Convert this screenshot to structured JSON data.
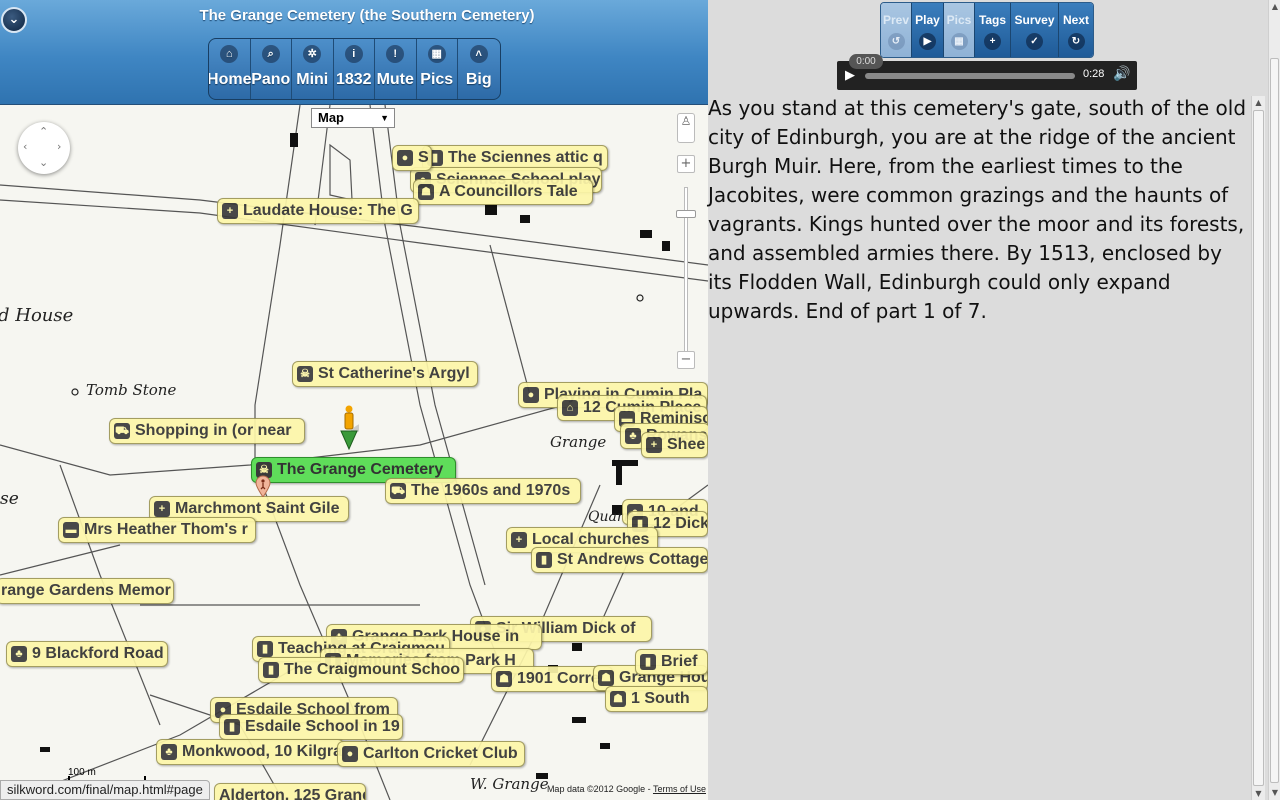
{
  "header": {
    "title": "The Grange Cemetery (the Southern Cemetery)",
    "nav": [
      {
        "label": "Home",
        "icon": "home-icon",
        "glyph": "⌂"
      },
      {
        "label": "Pano",
        "icon": "search-icon",
        "glyph": "⌕"
      },
      {
        "label": "Mini",
        "icon": "gear-icon",
        "glyph": "✲"
      },
      {
        "label": "1832",
        "icon": "info-icon",
        "glyph": "i"
      },
      {
        "label": "Mute",
        "icon": "alert-icon",
        "glyph": "!"
      },
      {
        "label": "Pics",
        "icon": "grid-icon",
        "glyph": "▦"
      },
      {
        "label": "Big",
        "icon": "chevron-up-icon",
        "glyph": "˄"
      }
    ]
  },
  "map": {
    "type_selector": "Map",
    "labels": {
      "house": "d House",
      "tombstone": "Tomb Stone",
      "grange": "Grange",
      "quarry": "Quarry",
      "se": "se",
      "street": "W. Grange"
    },
    "pins": [
      {
        "label": "The Sciennes attic q",
        "icon": "book-icon",
        "glyph": "▮"
      },
      {
        "label": "Sciennes School play",
        "icon": "pin-icon",
        "glyph": "●"
      },
      {
        "label": "S",
        "icon": "pin-icon",
        "glyph": "●"
      },
      {
        "label": "A Councillors Tale",
        "icon": "person-icon",
        "glyph": "☗"
      },
      {
        "label": "Laudate House: The G",
        "icon": "plus-icon",
        "glyph": "+"
      },
      {
        "label": "St Catherine's Argyl",
        "icon": "skull-icon",
        "glyph": "☠"
      },
      {
        "label": "Playing in Cumin Pla",
        "icon": "pin-icon",
        "glyph": "●"
      },
      {
        "label": "12 Cumin Place",
        "icon": "house-icon",
        "glyph": "⌂"
      },
      {
        "label": "Reminisc",
        "icon": "chat-icon",
        "glyph": "▬"
      },
      {
        "label": "Rowans",
        "icon": "tree-icon",
        "glyph": "♣"
      },
      {
        "label": "Shee",
        "icon": "plus-icon",
        "glyph": "+"
      },
      {
        "label": "Shopping in (or near",
        "icon": "cart-icon",
        "glyph": "⛟"
      },
      {
        "label": "The Grange Cemetery",
        "icon": "skull-icon",
        "glyph": "☠"
      },
      {
        "label": "The 1960s and 1970s",
        "icon": "cart-icon",
        "glyph": "⛟"
      },
      {
        "label": "Marchmont Saint Gile",
        "icon": "plus-icon",
        "glyph": "+"
      },
      {
        "label": "Mrs Heather Thom's r",
        "icon": "chat-icon",
        "glyph": "▬"
      },
      {
        "label": "10 and",
        "icon": "pin-icon",
        "glyph": "●"
      },
      {
        "label": "12 Dick",
        "icon": "book-icon",
        "glyph": "▮"
      },
      {
        "label": "Local churches",
        "icon": "plus-icon",
        "glyph": "+"
      },
      {
        "label": "St Andrews Cottage",
        "icon": "book-icon",
        "glyph": "▮"
      },
      {
        "label": "range Gardens Memor",
        "icon": "none",
        "glyph": ""
      },
      {
        "label": "Sir William Dick of",
        "icon": "pin-icon",
        "glyph": "●"
      },
      {
        "label": "Grange Park House in",
        "icon": "tree-icon",
        "glyph": "♣"
      },
      {
        "label": "9 Blackford Road",
        "icon": "tree-icon",
        "glyph": "♣"
      },
      {
        "label": "Teaching at Craigmou",
        "icon": "book-icon",
        "glyph": "▮"
      },
      {
        "label": "Memories from Park H",
        "icon": "book-icon",
        "glyph": "▮"
      },
      {
        "label": "The Craigmount Schoo",
        "icon": "book-icon",
        "glyph": "▮"
      },
      {
        "label": "1901 Corre",
        "icon": "person-icon",
        "glyph": "☗"
      },
      {
        "label": "Grange Hou",
        "icon": "person-icon",
        "glyph": "☗"
      },
      {
        "label": "Brief",
        "icon": "book-icon",
        "glyph": "▮"
      },
      {
        "label": "1 South",
        "icon": "person-icon",
        "glyph": "☗"
      },
      {
        "label": "Esdaile School from",
        "icon": "pin-icon",
        "glyph": "●"
      },
      {
        "label": "Esdaile School in 19",
        "icon": "book-icon",
        "glyph": "▮"
      },
      {
        "label": "Monkwood, 10 Kilgra",
        "icon": "tree-icon",
        "glyph": "♣"
      },
      {
        "label": "Carlton Cricket Club",
        "icon": "pin-icon",
        "glyph": "●"
      },
      {
        "label": "Alderton, 125 Grange",
        "icon": "none",
        "glyph": ""
      }
    ],
    "scale": "100 m",
    "attribution": "Map data ©2012 Google - ",
    "terms": "Terms of Use"
  },
  "status_url": "silkword.com/final/map.html#page",
  "tour": {
    "buttons": [
      {
        "label": "Prev",
        "icon": "undo-icon",
        "glyph": "↺",
        "disabled": true,
        "width": 31
      },
      {
        "label": "Play",
        "icon": "play-icon",
        "glyph": "▶",
        "disabled": false,
        "width": 32
      },
      {
        "label": "Pics",
        "icon": "grid-icon",
        "glyph": "▦",
        "disabled": true,
        "width": 31
      },
      {
        "label": "Tags",
        "icon": "plus-icon",
        "glyph": "+",
        "disabled": false,
        "width": 36
      },
      {
        "label": "Survey",
        "icon": "check-icon",
        "glyph": "✓",
        "disabled": false,
        "width": 48
      },
      {
        "label": "Next",
        "icon": "redo-icon",
        "glyph": "↻",
        "disabled": false,
        "width": 34
      }
    ]
  },
  "player": {
    "current_time": "0:00",
    "duration": "0:28"
  },
  "narration": "As you stand at this cemetery's gate, south of the old city of Edinburgh, you are at the ridge of the ancient Burgh Muir. Here, from the earliest times to the Jacobites, were common grazings and the haunts of vagrants. Kings hunted over the moor and its forests, and assembled armies there. By 1513, enclosed by its Flodden Wall, Edinburgh could only expand upwards. End of part 1 of 7."
}
